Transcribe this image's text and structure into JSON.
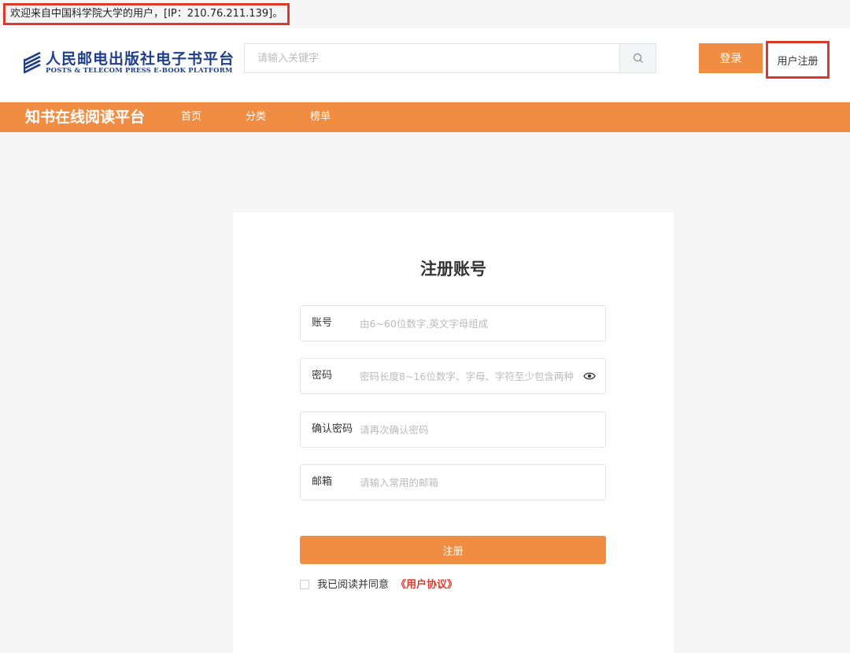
{
  "topbar": {
    "welcome": "欢迎来自中国科学院大学的用户，[IP：210.76.211.139]。"
  },
  "header": {
    "logo_cn": "人民邮电出版社电子书平台",
    "logo_en": "POSTS & TELECOM PRESS E-BOOK PLATFORM",
    "search_placeholder": "请输入关键字",
    "search_icon": "search-icon",
    "login_label": "登录",
    "register_label": "用户注册"
  },
  "nav": {
    "brand": "知书在线阅读平台",
    "items": [
      {
        "label": "首页"
      },
      {
        "label": "分类"
      },
      {
        "label": "榜单"
      }
    ]
  },
  "form": {
    "title": "注册账号",
    "fields": [
      {
        "label": "账号",
        "placeholder": "由6~60位数字,英文字母组成"
      },
      {
        "label": "密码",
        "placeholder": "密码长度8~16位数字、字母、字符至少包含两种",
        "icon": "eye-icon"
      },
      {
        "label": "确认密码",
        "placeholder": "请再次确认密码"
      },
      {
        "label": "邮箱",
        "placeholder": "请输入常用的邮箱"
      }
    ],
    "submit_label": "注册",
    "agree_text": "我已阅读并同意",
    "agree_link": "《用户协议》"
  },
  "colors": {
    "accent": "#f08d42",
    "highlight": "#d93a2b",
    "logo_blue": "#1f3f87"
  }
}
